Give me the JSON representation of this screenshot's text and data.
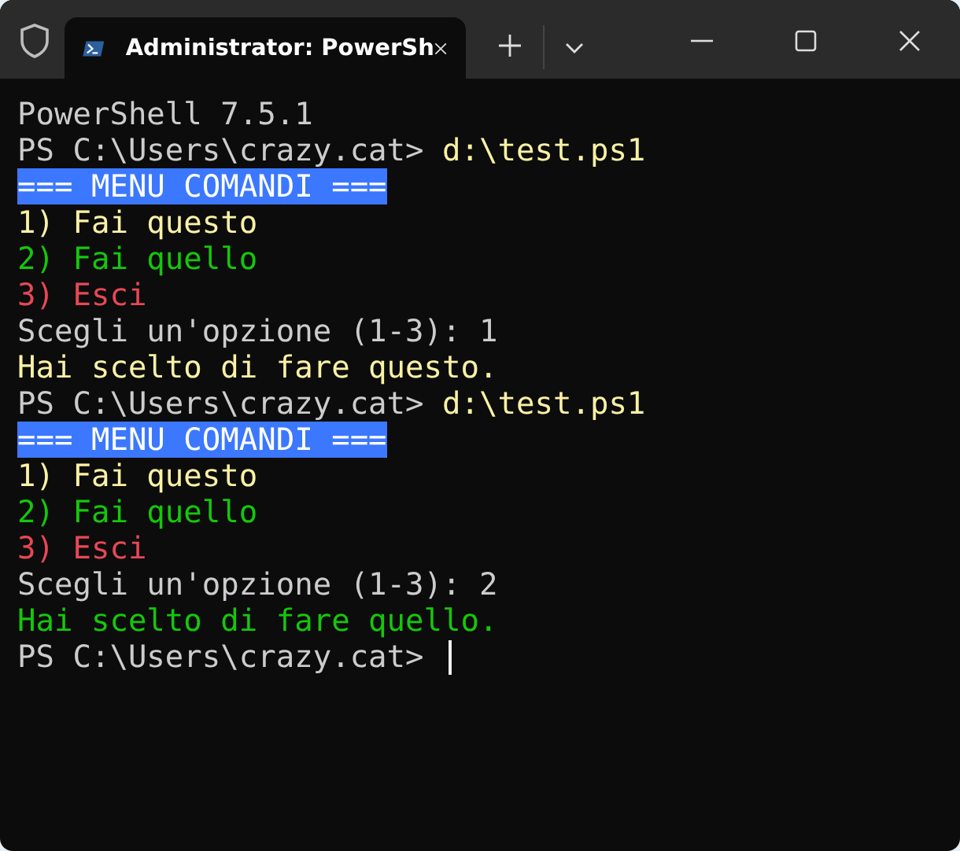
{
  "window": {
    "tab": {
      "title": "Administrator: PowerSh",
      "selected": true
    }
  },
  "terminal": {
    "lines": [
      {
        "segments": [
          {
            "text": "PowerShell 7.5.1",
            "kind": "text",
            "color": "#cccccc"
          }
        ]
      },
      {
        "segments": [
          {
            "text": "PS C:\\Users\\crazy.cat> ",
            "kind": "text",
            "color": "#cccccc"
          },
          {
            "text": "d:\\test.ps1",
            "kind": "text",
            "color": "#f9f1a5"
          }
        ]
      },
      {
        "segments": [
          {
            "text": "=== MENU COMANDI ===",
            "kind": "banner",
            "color": "#3b78ff"
          }
        ]
      },
      {
        "segments": [
          {
            "text": "1) Fai questo",
            "kind": "text",
            "color": "#f9f1a5"
          }
        ]
      },
      {
        "segments": [
          {
            "text": "2) Fai quello",
            "kind": "text",
            "color": "#16c60c"
          }
        ]
      },
      {
        "segments": [
          {
            "text": "3) Esci",
            "kind": "text",
            "color": "#e74856"
          }
        ]
      },
      {
        "segments": [
          {
            "text": "Scegli un'opzione (1-3): 1",
            "kind": "text",
            "color": "#cccccc"
          }
        ]
      },
      {
        "segments": [
          {
            "text": "Hai scelto di fare questo.",
            "kind": "text",
            "color": "#f9f1a5"
          }
        ]
      },
      {
        "segments": [
          {
            "text": "PS C:\\Users\\crazy.cat> ",
            "kind": "text",
            "color": "#cccccc"
          },
          {
            "text": "d:\\test.ps1",
            "kind": "text",
            "color": "#f9f1a5"
          }
        ]
      },
      {
        "segments": [
          {
            "text": "=== MENU COMANDI ===",
            "kind": "banner",
            "color": "#3b78ff"
          }
        ]
      },
      {
        "segments": [
          {
            "text": "1) Fai questo",
            "kind": "text",
            "color": "#f9f1a5"
          }
        ]
      },
      {
        "segments": [
          {
            "text": "2) Fai quello",
            "kind": "text",
            "color": "#16c60c"
          }
        ]
      },
      {
        "segments": [
          {
            "text": "3) Esci",
            "kind": "text",
            "color": "#e74856"
          }
        ]
      },
      {
        "segments": [
          {
            "text": "Scegli un'opzione (1-3): 2",
            "kind": "text",
            "color": "#cccccc"
          }
        ]
      },
      {
        "segments": [
          {
            "text": "Hai scelto di fare quello.",
            "kind": "text",
            "color": "#16c60c"
          }
        ]
      },
      {
        "segments": [
          {
            "text": "PS C:\\Users\\crazy.cat> ",
            "kind": "text",
            "color": "#cccccc"
          }
        ],
        "cursor": true
      }
    ]
  }
}
